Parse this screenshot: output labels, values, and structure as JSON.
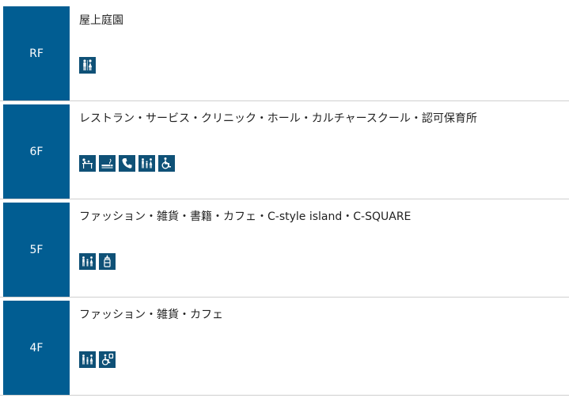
{
  "floors": [
    {
      "label": "RF",
      "description": "屋上庭園",
      "icons": [
        "restroom-icon"
      ]
    },
    {
      "label": "6F",
      "description": "レストラン・サービス・クリニック・ホール・カルチャースクール・認可保育所",
      "icons": [
        "baby-changing-icon",
        "smoking-area-icon",
        "telephone-icon",
        "family-restroom-icon",
        "wheelchair-icon"
      ]
    },
    {
      "label": "5F",
      "description": "ファッション・雑貨・書籍・カフェ・C-style island・C-SQUARE",
      "icons": [
        "family-restroom-icon",
        "feeding-bottle-icon"
      ]
    },
    {
      "label": "4F",
      "description": "ファッション・雑貨・カフェ",
      "icons": [
        "family-restroom-icon",
        "accessible-restroom-icon"
      ]
    }
  ],
  "colors": {
    "floor_label_bg": "#015d92",
    "icon_bg": "#0f5177",
    "divider": "#cfcfcf"
  }
}
